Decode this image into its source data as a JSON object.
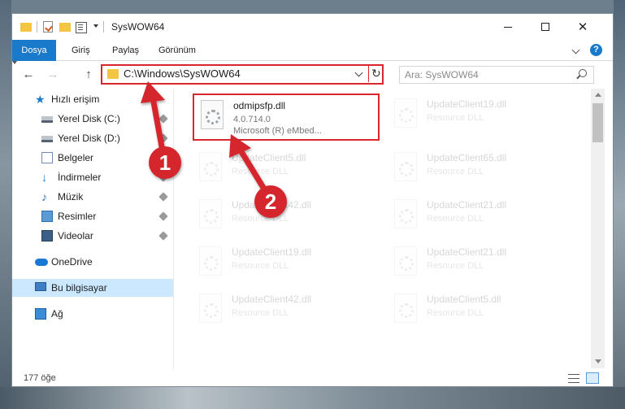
{
  "window": {
    "title": "SysWOW64",
    "controls": {
      "minimize": "—",
      "maximize": "☐",
      "close": "✕"
    }
  },
  "ribbon": {
    "tabs": [
      "Dosya",
      "Giriş",
      "Paylaş",
      "Görünüm"
    ],
    "active_tab": "Dosya",
    "help": "?"
  },
  "navbar": {
    "address": "C:\\Windows\\SysWOW64",
    "search_placeholder": "Ara: SysWOW64"
  },
  "sidebar": {
    "items": [
      {
        "label": "Hızlı erişim",
        "icon": "star-icon"
      },
      {
        "label": "Yerel Disk (C:)",
        "icon": "disk-icon",
        "pinned": true
      },
      {
        "label": "Yerel Disk (D:)",
        "icon": "disk-icon",
        "pinned": true
      },
      {
        "label": "Belgeler",
        "icon": "document-icon",
        "pinned": true
      },
      {
        "label": "İndirmeler",
        "icon": "download-icon",
        "pinned": true
      },
      {
        "label": "Müzik",
        "icon": "music-icon",
        "pinned": true
      },
      {
        "label": "Resimler",
        "icon": "pictures-icon",
        "pinned": true
      },
      {
        "label": "Videolar",
        "icon": "videos-icon",
        "pinned": true
      },
      {
        "label": "OneDrive",
        "icon": "cloud-icon"
      },
      {
        "label": "Bu bilgisayar",
        "icon": "computer-icon",
        "selected": true
      },
      {
        "label": "Ağ",
        "icon": "network-icon"
      }
    ]
  },
  "files": [
    {
      "name": "odmipsfp.dll",
      "line2": "4.0.714.0",
      "line3": "Microsoft (R) eMbed...",
      "highlighted": true
    },
    {
      "name": "UpdateClient19.dll",
      "line2": "Resource DLL"
    },
    {
      "name": "UpdateClient5.dll",
      "line2": "Resource DLL"
    },
    {
      "name": "UpdateClient65.dll",
      "line2": "Resource DLL"
    },
    {
      "name": "UpdateClient42.dll",
      "line2": "Resource DLL"
    },
    {
      "name": "UpdateClient21.dll",
      "line2": "Resource DLL"
    },
    {
      "name": "UpdateClient19.dll",
      "line2": "Resource DLL"
    },
    {
      "name": "UpdateClient21.dll",
      "line2": "Resource DLL"
    },
    {
      "name": "UpdateClient42.dll",
      "line2": "Resource DLL"
    },
    {
      "name": "UpdateClient5.dll",
      "line2": "Resource DLL"
    }
  ],
  "status": {
    "item_count": "177 öğe"
  },
  "callouts": {
    "step1": "1",
    "step2": "2"
  },
  "colors": {
    "accent": "#1979ca",
    "callout": "#d5262d",
    "folder": "#f3c543"
  }
}
